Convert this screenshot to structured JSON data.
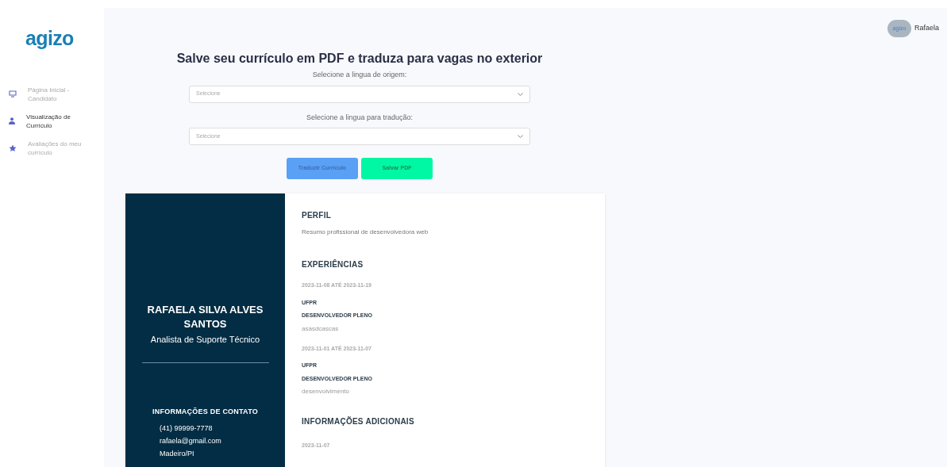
{
  "sidebar": {
    "logo": "agizo",
    "items": [
      {
        "label": "Página Inicial - Candidato",
        "kind": "monitor",
        "selected": false
      },
      {
        "label": "Visualização de Currículo",
        "kind": "person",
        "selected": true
      },
      {
        "label": "Avaliações do meu currículo",
        "kind": "star",
        "selected": false
      }
    ]
  },
  "user": {
    "avatar_text": "agizo",
    "name": "Rafaela"
  },
  "title": "Salve seu currículo em PDF e traduza para vagas no exterior",
  "fields": [
    {
      "label": "Selecione a lingua de origem:",
      "placeholder": "Selecione"
    },
    {
      "label": "Selecione a lingua para tradução:",
      "placeholder": "Selecione"
    }
  ],
  "buttons": [
    {
      "label": "Traduzir Curriculo",
      "kind": "translate"
    },
    {
      "label": "Salvar PDF",
      "kind": "save"
    }
  ],
  "resume": {
    "name": "RAFAELA SILVA ALVES SANTOS",
    "role": "Analista de Suporte Técnico",
    "contact_title": "INFORMAÇÕES DE CONTATO",
    "contacts": [
      "(41) 99999-7778",
      "rafaela@gmail.com",
      "Madeiro/PI"
    ],
    "profile_title": "PERFIL",
    "profile": "Resumo profissional de desenvolvedora web",
    "experience_title": "EXPERIÊNCIAS",
    "experiences": [
      {
        "period": "2023-11-08 ATÉ 2023-11-19",
        "company": "UFPR",
        "position": "DESENVOLVEDOR PLENO",
        "description": "asasdcascas"
      },
      {
        "period": "2023-11-01 ATÉ 2023-11-07",
        "company": "UFPR",
        "position": "DESENVOLVEDOR PLENO",
        "description": "desenvolvimento"
      }
    ],
    "additional_title": "INFORMAÇÕES ADICIONAIS",
    "additional": [
      {
        "date": "2023-11-07"
      }
    ]
  }
}
